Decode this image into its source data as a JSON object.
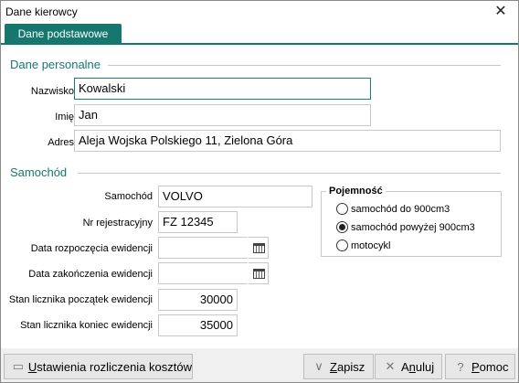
{
  "window": {
    "title": "Dane kierowcy",
    "close_glyph": "✕"
  },
  "tabs": [
    {
      "label": "Dane podstawowe",
      "active": true
    }
  ],
  "personal": {
    "section_title": "Dane personalne",
    "surname_label": "Nazwisko",
    "surname_value": "Kowalski",
    "name_label": "Imię",
    "name_value": "Jan",
    "address_label": "Adres",
    "address_value": "Aleja Wojska Polskiego 11, Zielona Góra"
  },
  "car": {
    "section_title": "Samochód",
    "car_label": "Samochód",
    "car_value": "VOLVO",
    "reg_label": "Nr rejestracyjny",
    "reg_value": "FZ 12345",
    "start_date_label": "Data rozpoczęcia ewidencji",
    "start_date_value": "",
    "end_date_label": "Data zakończenia ewidencji",
    "end_date_value": "",
    "odo_start_label": "Stan licznika początek ewidencji",
    "odo_start_value": "30000",
    "odo_end_label": "Stan licznika koniec ewidencji",
    "odo_end_value": "35000"
  },
  "capacity": {
    "title": "Pojemność",
    "options": [
      {
        "label": "samochód do 900cm3",
        "selected": false
      },
      {
        "label": "samochód powyżej 900cm3",
        "selected": true
      },
      {
        "label": "motocykl",
        "selected": false
      }
    ]
  },
  "buttons": {
    "settings_prefix": "",
    "settings_u": "U",
    "settings_rest": "stawienia rozliczenia kosztów",
    "save_u": "Z",
    "save_rest": "apisz",
    "cancel_prefix": "A",
    "cancel_u": "n",
    "cancel_rest": "uluj",
    "help_u": "P",
    "help_rest": "omoc"
  },
  "colors": {
    "accent": "#16776f"
  }
}
